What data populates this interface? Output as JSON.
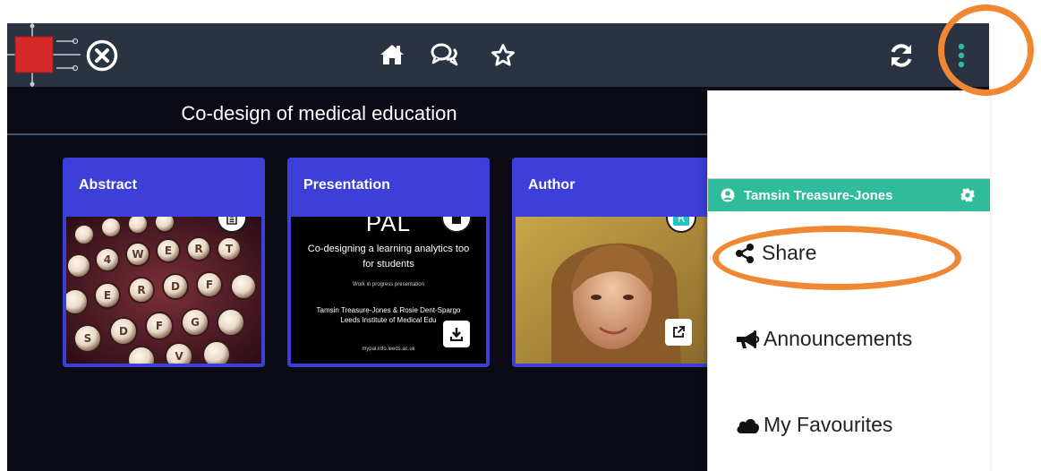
{
  "topbar": {
    "logo_icon": "circuit-logo-icon",
    "close_icon": "close-circle-icon",
    "home_icon": "home-icon",
    "chat_icon": "chat-icon",
    "favourite_icon": "star-icon",
    "refresh_icon": "refresh-icon",
    "more_icon": "vertical-dots-icon"
  },
  "page": {
    "title": "Co-design of medical education"
  },
  "cards": [
    {
      "title": "Abstract",
      "badge_icon": "document-icon"
    },
    {
      "title": "Presentation",
      "badge_icon": "file-icon",
      "action_icon": "download-icon",
      "slide": {
        "heading": "PAL",
        "line1": "Co-designing a learning analytics too",
        "line2": "for students",
        "line3": "Work in progress presentation",
        "line4": "Tamsin Treasure-Jones & Rosie Dent-Spargo",
        "line5": "Leeds Institute of Medical Edu",
        "line6": "mypal.info.leeds.ac.uk"
      }
    },
    {
      "title": "Author",
      "badge_icon": "profile-badge-icon",
      "action_icon": "external-link-icon"
    }
  ],
  "menu": {
    "user_name": "Tamsin Treasure-Jones",
    "user_icon": "user-circle-icon",
    "settings_icon": "gear-icon",
    "items": [
      {
        "label": "Share",
        "icon": "share-icon"
      },
      {
        "label": "Announcements",
        "icon": "megaphone-icon"
      },
      {
        "label": "My Favourites",
        "icon": "cloud-icon"
      }
    ]
  },
  "colors": {
    "topbar": "#2b3342",
    "card_header": "#3c3fd8",
    "accent": "#2ebc9b",
    "annotation": "#ef8733"
  }
}
